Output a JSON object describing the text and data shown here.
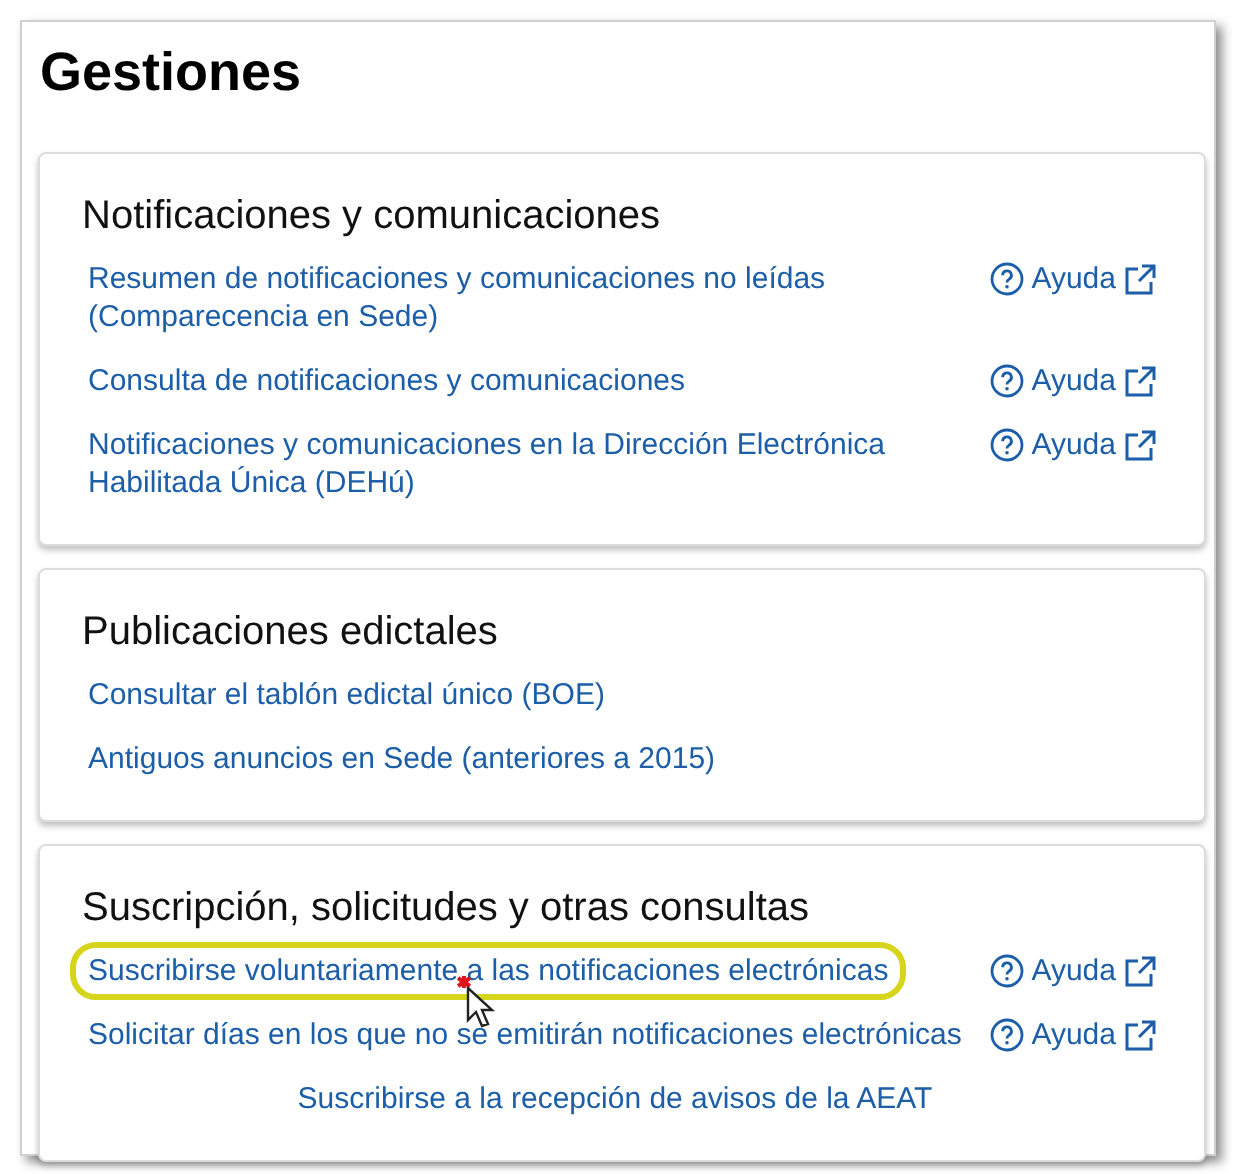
{
  "title": "Gestiones",
  "sections": [
    {
      "heading": "Notificaciones y comunicaciones",
      "items": [
        {
          "kind": "link",
          "label": "Resumen de notificaciones y comunicaciones no leídas (Comparecencia en Sede)",
          "help": "Ayuda",
          "highlighted": false
        },
        {
          "kind": "link",
          "label": "Consulta de notificaciones y comunicaciones",
          "help": "Ayuda",
          "highlighted": false
        },
        {
          "kind": "link",
          "label": "Notificaciones y comunicaciones en la Dirección Electrónica Habilitada Única (DEHú)",
          "help": "Ayuda",
          "highlighted": false
        }
      ]
    },
    {
      "heading": "Publicaciones edictales",
      "items": [
        {
          "kind": "link",
          "label": "Consultar el tablón edictal único (BOE)",
          "highlighted": false
        },
        {
          "kind": "link",
          "label": "Antiguos anuncios en Sede (anteriores a 2015)",
          "highlighted": false
        }
      ]
    },
    {
      "heading": "Suscripción, solicitudes y otras consultas",
      "items": [
        {
          "kind": "link",
          "label": "Suscribirse voluntariamente a las notificaciones electrónicas",
          "help": "Ayuda",
          "highlighted": true
        },
        {
          "kind": "link",
          "label": "Solicitar días en los que no se emitirán notificaciones electrónicas",
          "help": "Ayuda",
          "highlighted": false
        },
        {
          "kind": "centered",
          "label": "Suscribirse a la recepción de avisos de la AEAT",
          "highlighted": false
        }
      ]
    }
  ]
}
